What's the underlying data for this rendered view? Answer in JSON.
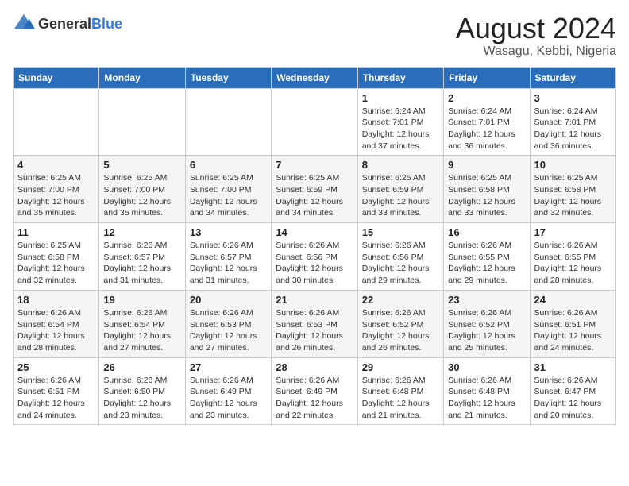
{
  "header": {
    "logo_general": "General",
    "logo_blue": "Blue",
    "main_title": "August 2024",
    "subtitle": "Wasagu, Kebbi, Nigeria"
  },
  "days_of_week": [
    "Sunday",
    "Monday",
    "Tuesday",
    "Wednesday",
    "Thursday",
    "Friday",
    "Saturday"
  ],
  "weeks": [
    [
      {
        "num": "",
        "info": ""
      },
      {
        "num": "",
        "info": ""
      },
      {
        "num": "",
        "info": ""
      },
      {
        "num": "",
        "info": ""
      },
      {
        "num": "1",
        "info": "Sunrise: 6:24 AM\nSunset: 7:01 PM\nDaylight: 12 hours\nand 37 minutes."
      },
      {
        "num": "2",
        "info": "Sunrise: 6:24 AM\nSunset: 7:01 PM\nDaylight: 12 hours\nand 36 minutes."
      },
      {
        "num": "3",
        "info": "Sunrise: 6:24 AM\nSunset: 7:01 PM\nDaylight: 12 hours\nand 36 minutes."
      }
    ],
    [
      {
        "num": "4",
        "info": "Sunrise: 6:25 AM\nSunset: 7:00 PM\nDaylight: 12 hours\nand 35 minutes."
      },
      {
        "num": "5",
        "info": "Sunrise: 6:25 AM\nSunset: 7:00 PM\nDaylight: 12 hours\nand 35 minutes."
      },
      {
        "num": "6",
        "info": "Sunrise: 6:25 AM\nSunset: 7:00 PM\nDaylight: 12 hours\nand 34 minutes."
      },
      {
        "num": "7",
        "info": "Sunrise: 6:25 AM\nSunset: 6:59 PM\nDaylight: 12 hours\nand 34 minutes."
      },
      {
        "num": "8",
        "info": "Sunrise: 6:25 AM\nSunset: 6:59 PM\nDaylight: 12 hours\nand 33 minutes."
      },
      {
        "num": "9",
        "info": "Sunrise: 6:25 AM\nSunset: 6:58 PM\nDaylight: 12 hours\nand 33 minutes."
      },
      {
        "num": "10",
        "info": "Sunrise: 6:25 AM\nSunset: 6:58 PM\nDaylight: 12 hours\nand 32 minutes."
      }
    ],
    [
      {
        "num": "11",
        "info": "Sunrise: 6:25 AM\nSunset: 6:58 PM\nDaylight: 12 hours\nand 32 minutes."
      },
      {
        "num": "12",
        "info": "Sunrise: 6:26 AM\nSunset: 6:57 PM\nDaylight: 12 hours\nand 31 minutes."
      },
      {
        "num": "13",
        "info": "Sunrise: 6:26 AM\nSunset: 6:57 PM\nDaylight: 12 hours\nand 31 minutes."
      },
      {
        "num": "14",
        "info": "Sunrise: 6:26 AM\nSunset: 6:56 PM\nDaylight: 12 hours\nand 30 minutes."
      },
      {
        "num": "15",
        "info": "Sunrise: 6:26 AM\nSunset: 6:56 PM\nDaylight: 12 hours\nand 29 minutes."
      },
      {
        "num": "16",
        "info": "Sunrise: 6:26 AM\nSunset: 6:55 PM\nDaylight: 12 hours\nand 29 minutes."
      },
      {
        "num": "17",
        "info": "Sunrise: 6:26 AM\nSunset: 6:55 PM\nDaylight: 12 hours\nand 28 minutes."
      }
    ],
    [
      {
        "num": "18",
        "info": "Sunrise: 6:26 AM\nSunset: 6:54 PM\nDaylight: 12 hours\nand 28 minutes."
      },
      {
        "num": "19",
        "info": "Sunrise: 6:26 AM\nSunset: 6:54 PM\nDaylight: 12 hours\nand 27 minutes."
      },
      {
        "num": "20",
        "info": "Sunrise: 6:26 AM\nSunset: 6:53 PM\nDaylight: 12 hours\nand 27 minutes."
      },
      {
        "num": "21",
        "info": "Sunrise: 6:26 AM\nSunset: 6:53 PM\nDaylight: 12 hours\nand 26 minutes."
      },
      {
        "num": "22",
        "info": "Sunrise: 6:26 AM\nSunset: 6:52 PM\nDaylight: 12 hours\nand 26 minutes."
      },
      {
        "num": "23",
        "info": "Sunrise: 6:26 AM\nSunset: 6:52 PM\nDaylight: 12 hours\nand 25 minutes."
      },
      {
        "num": "24",
        "info": "Sunrise: 6:26 AM\nSunset: 6:51 PM\nDaylight: 12 hours\nand 24 minutes."
      }
    ],
    [
      {
        "num": "25",
        "info": "Sunrise: 6:26 AM\nSunset: 6:51 PM\nDaylight: 12 hours\nand 24 minutes."
      },
      {
        "num": "26",
        "info": "Sunrise: 6:26 AM\nSunset: 6:50 PM\nDaylight: 12 hours\nand 23 minutes."
      },
      {
        "num": "27",
        "info": "Sunrise: 6:26 AM\nSunset: 6:49 PM\nDaylight: 12 hours\nand 23 minutes."
      },
      {
        "num": "28",
        "info": "Sunrise: 6:26 AM\nSunset: 6:49 PM\nDaylight: 12 hours\nand 22 minutes."
      },
      {
        "num": "29",
        "info": "Sunrise: 6:26 AM\nSunset: 6:48 PM\nDaylight: 12 hours\nand 21 minutes."
      },
      {
        "num": "30",
        "info": "Sunrise: 6:26 AM\nSunset: 6:48 PM\nDaylight: 12 hours\nand 21 minutes."
      },
      {
        "num": "31",
        "info": "Sunrise: 6:26 AM\nSunset: 6:47 PM\nDaylight: 12 hours\nand 20 minutes."
      }
    ]
  ]
}
